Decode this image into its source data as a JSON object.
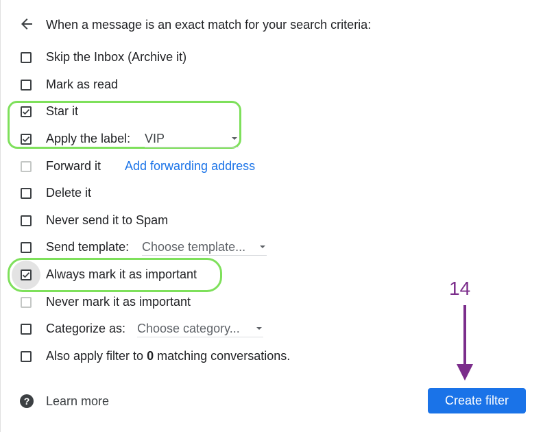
{
  "header": {
    "text": "When a message is an exact match for your search criteria:"
  },
  "options": {
    "skip_inbox": "Skip the Inbox (Archive it)",
    "mark_read": "Mark as read",
    "star_it": "Star it",
    "apply_label": "Apply the label:",
    "label_value": "VIP",
    "forward_it": "Forward it",
    "add_forwarding": "Add forwarding address",
    "delete_it": "Delete it",
    "never_spam": "Never send it to Spam",
    "send_template": "Send template:",
    "template_value": "Choose template...",
    "always_important": "Always mark it as important",
    "never_important": "Never mark it as important",
    "categorize": "Categorize as:",
    "category_value": "Choose category...",
    "also_apply_prefix": "Also apply filter to",
    "also_apply_count": "0",
    "also_apply_suffix": "matching conversations."
  },
  "checked": {
    "skip_inbox": false,
    "mark_read": false,
    "star_it": true,
    "apply_label": true,
    "forward_it": false,
    "delete_it": false,
    "never_spam": false,
    "send_template": false,
    "always_important": true,
    "never_important": false,
    "categorize": false,
    "also_apply": false
  },
  "footer": {
    "learn_more": "Learn more",
    "create_filter": "Create filter",
    "help_symbol": "?"
  },
  "annotation": {
    "step_number": "14"
  },
  "colors": {
    "accent": "#1a73e8",
    "highlight": "#7ee05b",
    "annotation": "#7b2d8b"
  }
}
